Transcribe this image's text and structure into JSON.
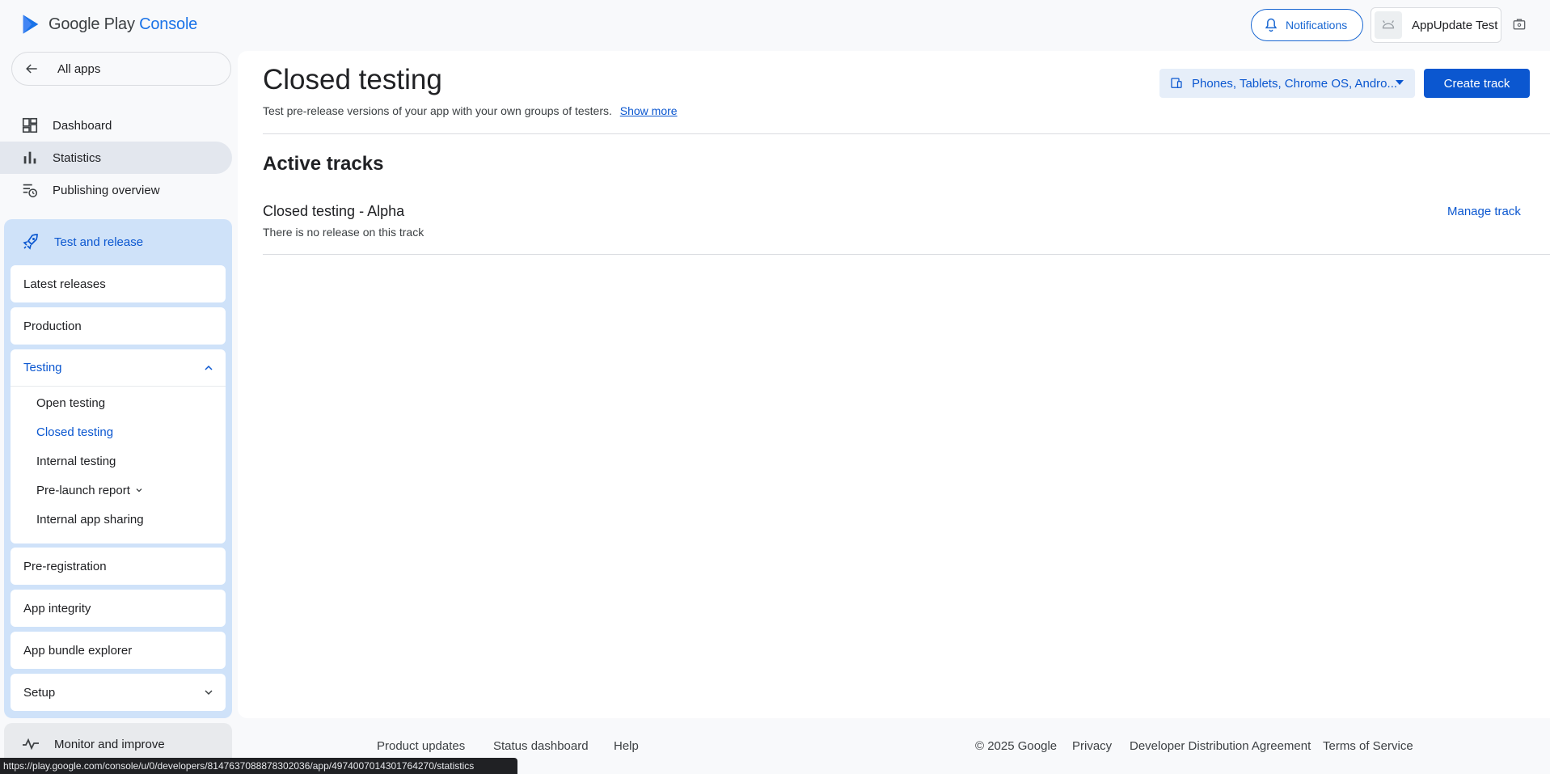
{
  "header": {
    "logo_google": "Google Play",
    "logo_console": "Console",
    "notifications_label": "Notifications",
    "account_name": "AppUpdate Test"
  },
  "sidebar": {
    "all_apps": "All apps",
    "items": [
      {
        "label": "Dashboard",
        "icon": "dashboard-icon"
      },
      {
        "label": "Statistics",
        "icon": "bar-chart-icon"
      },
      {
        "label": "Publishing overview",
        "icon": "publishing-icon"
      }
    ],
    "test_release": {
      "title": "Test and release",
      "latest_releases": "Latest releases",
      "production": "Production",
      "testing": {
        "label": "Testing",
        "items": [
          "Open testing",
          "Closed testing",
          "Internal testing",
          "Pre-launch report",
          "Internal app sharing"
        ]
      },
      "pre_registration": "Pre-registration",
      "app_integrity": "App integrity",
      "app_bundle_explorer": "App bundle explorer",
      "setup": "Setup"
    },
    "monitor": "Monitor and improve"
  },
  "main": {
    "title": "Closed testing",
    "subtitle": "Test pre-release versions of your app with your own groups of testers.",
    "show_more": "Show more",
    "device_selector": "Phones, Tablets, Chrome OS, Andro...",
    "create_track": "Create track",
    "section_title": "Active tracks",
    "track": {
      "name": "Closed testing - Alpha",
      "description": "There is no release on this track",
      "manage": "Manage track"
    }
  },
  "footer": {
    "links_left": [
      "Product updates",
      "Status dashboard",
      "Help"
    ],
    "copyright": "© 2025 Google",
    "links_right": [
      "Privacy",
      "Developer Distribution Agreement",
      "Terms of Service"
    ]
  },
  "statusbar": {
    "url": "https://play.google.com/console/u/0/developers/8147637088878302036/app/4974007014301764270/statistics"
  },
  "colors": {
    "accent": "#0b57d0",
    "nav_selected": "#e3e7ee",
    "section_bg": "#cfe2f9"
  }
}
